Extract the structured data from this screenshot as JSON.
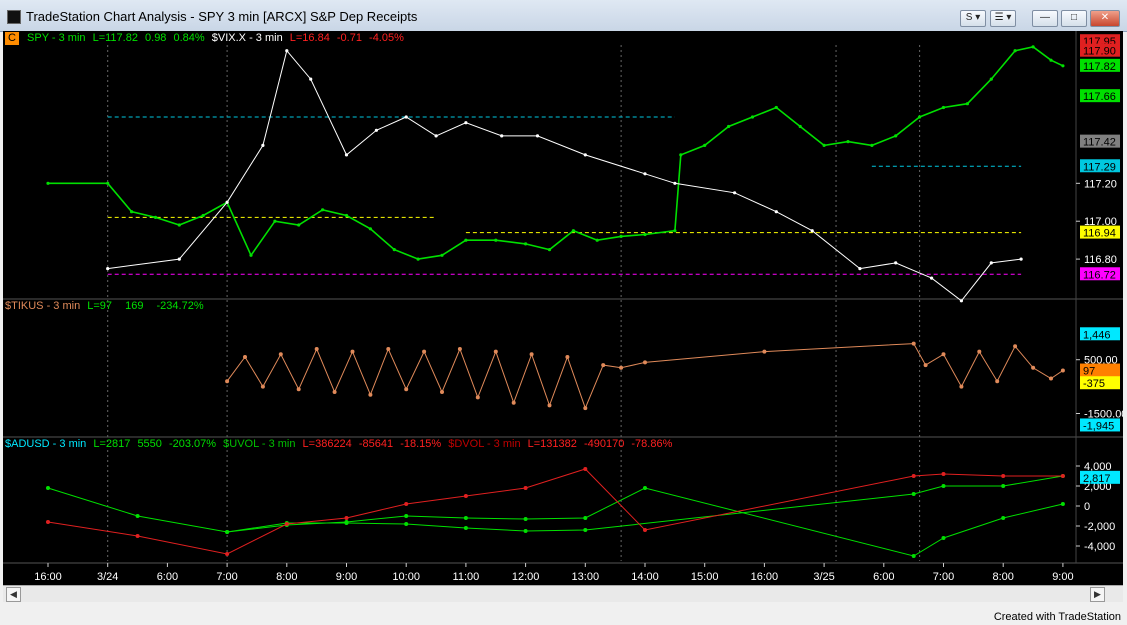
{
  "window": {
    "title": "TradeStation Chart Analysis - SPY 3 min [ARCX] S&P Dep Receipts",
    "buttons": {
      "sync": "S",
      "link": "☰"
    }
  },
  "chart_data": [
    {
      "type": "line",
      "pane": "price",
      "header": {
        "badge": "C",
        "symbol": "SPY - 3 min",
        "last": "L=117.82",
        "change": "0.98",
        "pct": "0.84%",
        "symbol2": "$VIX.X - 3 min",
        "last2": "L=16.84",
        "change2": "-0.71",
        "pct2": "-4.05%"
      },
      "ylim": [
        116.6,
        117.93
      ],
      "y_ticks": [
        117.2,
        117.0,
        116.8
      ],
      "price_tags": [
        {
          "label": "117.95",
          "value": 117.95,
          "color": "#e02020"
        },
        {
          "label": "117.90",
          "value": 117.9,
          "color": "#e02020"
        },
        {
          "label": "117.82",
          "value": 117.82,
          "color": "#00e000"
        },
        {
          "label": "117.66",
          "value": 117.66,
          "color": "#00e000"
        },
        {
          "label": "117.42",
          "value": 117.42,
          "color": "#808080"
        },
        {
          "label": "117.29",
          "value": 117.29,
          "color": "#00c8e0"
        },
        {
          "label": "116.94",
          "value": 116.94,
          "color": "#ffff00"
        },
        {
          "label": "116.72",
          "value": 116.72,
          "color": "#ff00ff"
        }
      ],
      "levels": [
        {
          "value": 117.55,
          "color": "#00c8e0",
          "x_from": 1.0,
          "x_to": 10.5
        },
        {
          "value": 117.02,
          "color": "#ffff00",
          "x_from": 1.0,
          "x_to": 6.5
        },
        {
          "value": 116.94,
          "color": "#ffff00",
          "x_from": 7.0,
          "x_to": 16.3
        },
        {
          "value": 117.29,
          "color": "#00c8e0",
          "x_from": 13.8,
          "x_to": 16.3
        },
        {
          "value": 116.72,
          "color": "#ff00ff",
          "x_from": 1.0,
          "x_to": 16.3
        }
      ],
      "series": [
        {
          "name": "SPY",
          "color": "#00e000",
          "points": [
            [
              0.0,
              117.2
            ],
            [
              1.0,
              117.2
            ],
            [
              1.4,
              117.05
            ],
            [
              1.8,
              117.02
            ],
            [
              2.2,
              116.98
            ],
            [
              2.6,
              117.03
            ],
            [
              3.0,
              117.1
            ],
            [
              3.4,
              116.82
            ],
            [
              3.8,
              117.0
            ],
            [
              4.2,
              116.98
            ],
            [
              4.6,
              117.06
            ],
            [
              5.0,
              117.03
            ],
            [
              5.4,
              116.96
            ],
            [
              5.8,
              116.85
            ],
            [
              6.2,
              116.8
            ],
            [
              6.6,
              116.82
            ],
            [
              7.0,
              116.9
            ],
            [
              7.5,
              116.9
            ],
            [
              8.0,
              116.88
            ],
            [
              8.4,
              116.85
            ],
            [
              8.8,
              116.95
            ],
            [
              9.2,
              116.9
            ],
            [
              9.6,
              116.92
            ],
            [
              10.0,
              116.93
            ],
            [
              10.5,
              116.95
            ],
            [
              10.6,
              117.35
            ],
            [
              11.0,
              117.4
            ],
            [
              11.4,
              117.5
            ],
            [
              11.8,
              117.55
            ],
            [
              12.2,
              117.6
            ],
            [
              12.6,
              117.5
            ],
            [
              13.0,
              117.4
            ],
            [
              13.4,
              117.42
            ],
            [
              13.8,
              117.4
            ],
            [
              14.2,
              117.45
            ],
            [
              14.6,
              117.55
            ],
            [
              15.0,
              117.6
            ],
            [
              15.4,
              117.62
            ],
            [
              15.8,
              117.75
            ],
            [
              16.2,
              117.9
            ],
            [
              16.5,
              117.92
            ],
            [
              16.8,
              117.85
            ],
            [
              17.0,
              117.82
            ]
          ]
        },
        {
          "name": "$VIX.X",
          "color": "#ffffff",
          "points": [
            [
              1.0,
              116.75
            ],
            [
              2.2,
              116.8
            ],
            [
              3.0,
              117.1
            ],
            [
              3.6,
              117.4
            ],
            [
              4.0,
              117.9
            ],
            [
              4.4,
              117.75
            ],
            [
              5.0,
              117.35
            ],
            [
              5.5,
              117.48
            ],
            [
              6.0,
              117.55
            ],
            [
              6.5,
              117.45
            ],
            [
              7.0,
              117.52
            ],
            [
              7.6,
              117.45
            ],
            [
              8.2,
              117.45
            ],
            [
              9.0,
              117.35
            ],
            [
              10.0,
              117.25
            ],
            [
              10.5,
              117.2
            ],
            [
              11.5,
              117.15
            ],
            [
              12.2,
              117.05
            ],
            [
              12.8,
              116.95
            ],
            [
              13.6,
              116.75
            ],
            [
              14.2,
              116.78
            ],
            [
              14.8,
              116.7
            ],
            [
              15.3,
              116.58
            ],
            [
              15.8,
              116.78
            ],
            [
              16.3,
              116.8
            ]
          ]
        }
      ]
    },
    {
      "type": "line",
      "pane": "tick",
      "header": {
        "symbol": "$TIKUS - 3 min",
        "last": "L=97",
        "change": "169",
        "pct": "-234.72%"
      },
      "ylim": [
        -2300,
        2200
      ],
      "y_ticks": [
        500,
        -1500
      ],
      "price_tags": [
        {
          "label": "1,446",
          "value": 1446,
          "color": "#00e8ff"
        },
        {
          "label": "97",
          "value": 97,
          "color": "#ff8000"
        },
        {
          "label": "-375",
          "value": -375,
          "color": "#ffff00"
        },
        {
          "label": "-1,945",
          "value": -1945,
          "color": "#00e8ff"
        }
      ],
      "series": [
        {
          "name": "$TIKUS",
          "color": "#e08a5a",
          "points": [
            [
              3.0,
              -300
            ],
            [
              3.3,
              600
            ],
            [
              3.6,
              -500
            ],
            [
              3.9,
              700
            ],
            [
              4.2,
              -600
            ],
            [
              4.5,
              900
            ],
            [
              4.8,
              -700
            ],
            [
              5.1,
              800
            ],
            [
              5.4,
              -800
            ],
            [
              5.7,
              900
            ],
            [
              6.0,
              -600
            ],
            [
              6.3,
              800
            ],
            [
              6.6,
              -700
            ],
            [
              6.9,
              900
            ],
            [
              7.2,
              -900
            ],
            [
              7.5,
              800
            ],
            [
              7.8,
              -1100
            ],
            [
              8.1,
              700
            ],
            [
              8.4,
              -1200
            ],
            [
              8.7,
              600
            ],
            [
              9.0,
              -1300
            ],
            [
              9.3,
              300
            ],
            [
              9.6,
              200
            ],
            [
              10.0,
              400
            ],
            [
              12.0,
              800
            ],
            [
              14.5,
              1100
            ],
            [
              14.7,
              300
            ],
            [
              15.0,
              700
            ],
            [
              15.3,
              -500
            ],
            [
              15.6,
              800
            ],
            [
              15.9,
              -300
            ],
            [
              16.2,
              1000
            ],
            [
              16.5,
              200
            ],
            [
              16.8,
              -200
            ],
            [
              17.0,
              100
            ]
          ]
        }
      ]
    },
    {
      "type": "line",
      "pane": "breadth",
      "header": {
        "symbol": "$ADUSD - 3 min",
        "last": "L=2817",
        "change": "5550",
        "pct": "-203.07%",
        "symbol2": "$UVOL - 3 min",
        "last2": "L=386224",
        "change2": "-85641",
        "pct2": "-18.15%",
        "symbol3": "$DVOL - 3 min",
        "last3": "L=131382",
        "change3": "-490170",
        "pct3": "-78.86%"
      },
      "ylim": [
        -5500,
        5500
      ],
      "y_ticks": [
        4000,
        2000,
        0,
        -2000,
        -4000
      ],
      "y_tick_labels": [
        "4,000",
        "2,000",
        "0",
        "-2,000",
        "-4,000"
      ],
      "price_tags": [
        {
          "label": "2,817",
          "value": 2817,
          "color": "#00e8ff"
        }
      ],
      "series": [
        {
          "name": "$ADUSD",
          "color": "#00e000",
          "points": [
            [
              0.0,
              1800
            ],
            [
              1.5,
              -1000
            ],
            [
              3.0,
              -2600
            ],
            [
              4.0,
              -1900
            ],
            [
              5.0,
              -1600
            ],
            [
              6.0,
              -1000
            ],
            [
              7.0,
              -1200
            ],
            [
              8.0,
              -1300
            ],
            [
              9.0,
              -1200
            ],
            [
              10.0,
              1800
            ],
            [
              14.5,
              -5000
            ],
            [
              15.0,
              -3200
            ],
            [
              16.0,
              -1200
            ],
            [
              17.0,
              200
            ]
          ]
        },
        {
          "name": "$UVOL",
          "color": "#00e000",
          "points": [
            [
              3.0,
              -2600
            ],
            [
              4.0,
              -1700
            ],
            [
              5.0,
              -1700
            ],
            [
              6.0,
              -1800
            ],
            [
              7.0,
              -2200
            ],
            [
              8.0,
              -2500
            ],
            [
              9.0,
              -2400
            ],
            [
              14.5,
              1200
            ],
            [
              15.0,
              2000
            ],
            [
              16.0,
              2000
            ],
            [
              17.0,
              3000
            ]
          ]
        },
        {
          "name": "$DVOL",
          "color": "#e02020",
          "points": [
            [
              0.0,
              -1600
            ],
            [
              1.5,
              -3000
            ],
            [
              3.0,
              -4800
            ],
            [
              4.0,
              -1800
            ],
            [
              5.0,
              -1200
            ],
            [
              6.0,
              200
            ],
            [
              7.0,
              1000
            ],
            [
              8.0,
              1800
            ],
            [
              9.0,
              3700
            ],
            [
              10.0,
              -2400
            ],
            [
              14.5,
              3000
            ],
            [
              15.0,
              3200
            ],
            [
              16.0,
              3000
            ],
            [
              17.0,
              3000
            ]
          ]
        }
      ]
    }
  ],
  "x_axis": {
    "ticks": [
      "16:00",
      "3/24",
      "6:00",
      "7:00",
      "8:00",
      "9:00",
      "10:00",
      "11:00",
      "12:00",
      "13:00",
      "14:00",
      "15:00",
      "16:00",
      "3/25",
      "6:00",
      "7:00",
      "8:00",
      "9:00"
    ]
  },
  "footer": "Created with TradeStation",
  "colors": {
    "background": "#000000",
    "green": "#00e000",
    "red": "#e02020",
    "cyan": "#00e8ff"
  }
}
